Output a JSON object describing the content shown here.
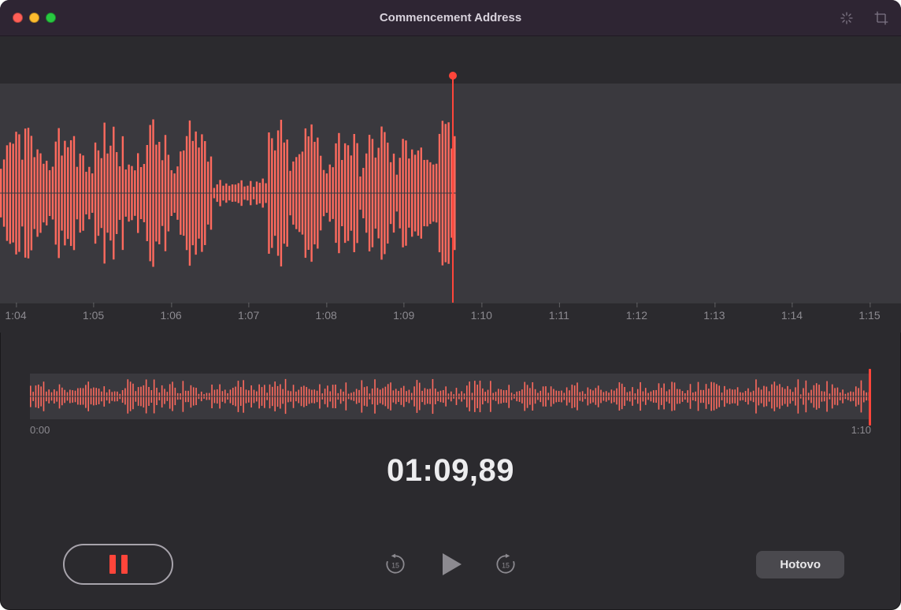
{
  "window": {
    "title": "Commencement Address"
  },
  "ruler": {
    "ticks": [
      "1:04",
      "1:05",
      "1:06",
      "1:07",
      "1:08",
      "1:09",
      "1:10",
      "1:11",
      "1:12",
      "1:13",
      "1:14",
      "1:15"
    ]
  },
  "overview": {
    "start_label": "0:00",
    "end_label": "1:10"
  },
  "timer": {
    "value": "01:09,89"
  },
  "controls": {
    "done_label": "Hotovo",
    "skip_seconds": "15"
  }
}
